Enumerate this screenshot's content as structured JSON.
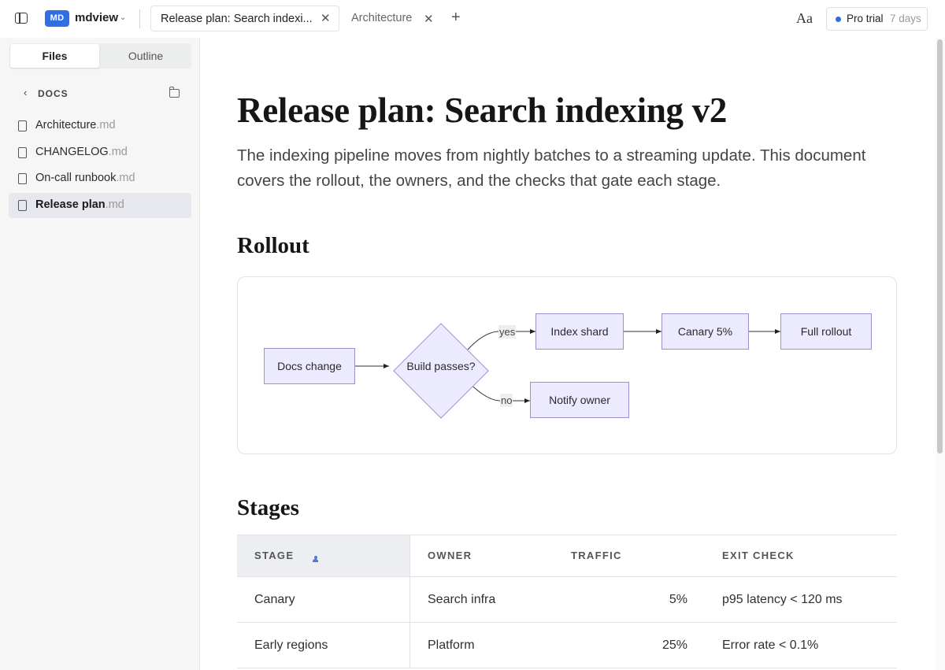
{
  "app": {
    "logo": "MD",
    "name": "mdview"
  },
  "tabs": [
    {
      "label": "Release plan: Search indexi...",
      "active": true
    },
    {
      "label": "Architecture",
      "active": false
    }
  ],
  "toolbar": {
    "font_button": "Aa",
    "trial_label": "Pro trial",
    "trial_days": "7 days"
  },
  "sidebar": {
    "segments": [
      "Files",
      "Outline"
    ],
    "section": "DOCS",
    "files": [
      {
        "name": "Architecture",
        "ext": ".md"
      },
      {
        "name": "CHANGELOG",
        "ext": ".md"
      },
      {
        "name": "On-call runbook",
        "ext": ".md"
      },
      {
        "name": "Release plan",
        "ext": ".md",
        "active": true
      }
    ]
  },
  "doc": {
    "title": "Release plan: Search indexing v2",
    "lede": "The indexing pipeline moves from nightly batches to a streaming update. This document covers the rollout, the owners, and the checks that gate each stage.",
    "rollout_heading": "Rollout",
    "stages_heading": "Stages"
  },
  "diagram": {
    "nodes": {
      "docs_change": "Docs change",
      "build_passes": "Build passes?",
      "index_shard": "Index shard",
      "notify_owner": "Notify owner",
      "canary": "Canary 5%",
      "full_rollout": "Full rollout"
    },
    "edges": {
      "yes": "yes",
      "no": "no"
    },
    "colors": {
      "node_fill": "#eceaff",
      "node_stroke": "#9e8fd1"
    }
  },
  "table": {
    "headers": [
      "STAGE",
      "OWNER",
      "TRAFFIC",
      "EXIT CHECK"
    ],
    "rows": [
      [
        "Canary",
        "Search infra",
        "5%",
        "p95 latency < 120 ms"
      ],
      [
        "Early regions",
        "Platform",
        "25%",
        "Error rate < 0.1%"
      ]
    ]
  },
  "colors": {
    "accent": "#2f6fe4"
  }
}
